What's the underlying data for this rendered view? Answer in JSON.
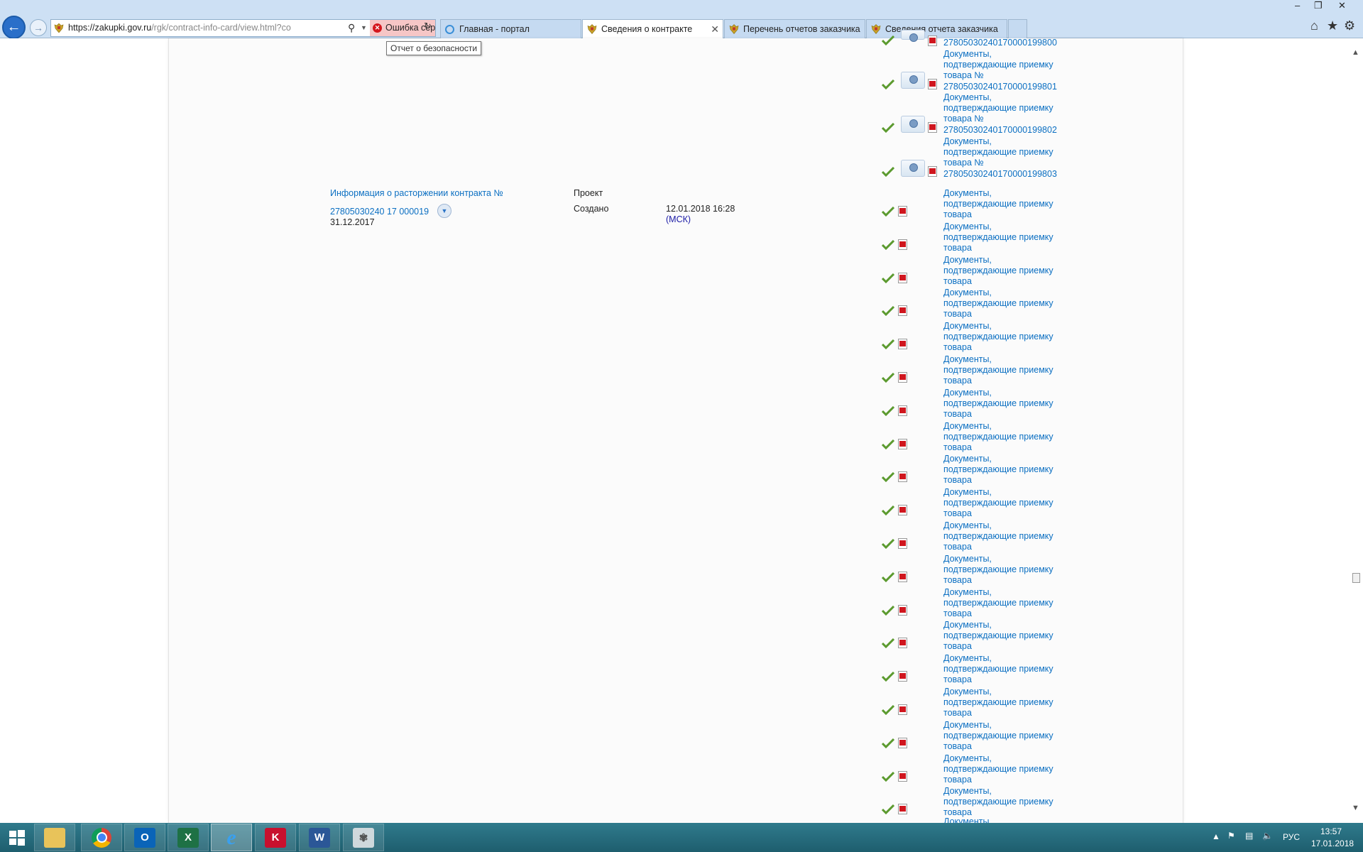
{
  "browser": {
    "url_host": "https://zakupki.gov.ru",
    "url_path": "/rgk/contract-info-card/view.html?co",
    "cert_error": "Ошибка сертификата",
    "tooltip": "Отчет о безопасности",
    "tabs": [
      {
        "label": "Главная - портал",
        "active": false
      },
      {
        "label": "Сведения о контракте",
        "active": true
      },
      {
        "label": "Перечень отчетов заказчика",
        "active": false
      },
      {
        "label": "Сведения отчета заказчика",
        "active": false
      }
    ]
  },
  "top_docs": [
    {
      "number": "27805030240170000199800"
    },
    {
      "line1": "Документы,",
      "line2": "подтверждающие приемку",
      "line3": "товара №",
      "number": "27805030240170000199801"
    },
    {
      "line1": "Документы,",
      "line2": "подтверждающие приемку",
      "line3": "товара №",
      "number": "27805030240170000199802"
    },
    {
      "line1": "Документы,",
      "line2": "подтверждающие приемку",
      "line3": "товара №",
      "number": "27805030240170000199803"
    }
  ],
  "termination": {
    "title": "Информация о расторжении контракта №",
    "number": "27805030240 17 000019",
    "date": "31.12.2017",
    "type": "Проект",
    "status": "Создано",
    "created": "12.01.2018 16:28",
    "tz": "(МСК)"
  },
  "doc_item": {
    "line1": "Документы,",
    "line2": "подтверждающие приемку",
    "line3": "товара"
  },
  "doc_rows_count_note": "",
  "last_partial": "Документы,",
  "taskbar": {
    "apps": [
      "Проводник",
      "Chrome",
      "Outlook",
      "Excel",
      "Internet Explorer",
      "Kaspersky",
      "Word",
      "Paint"
    ],
    "lang": "РУС",
    "time": "13:57",
    "date": "17.01.2018"
  }
}
